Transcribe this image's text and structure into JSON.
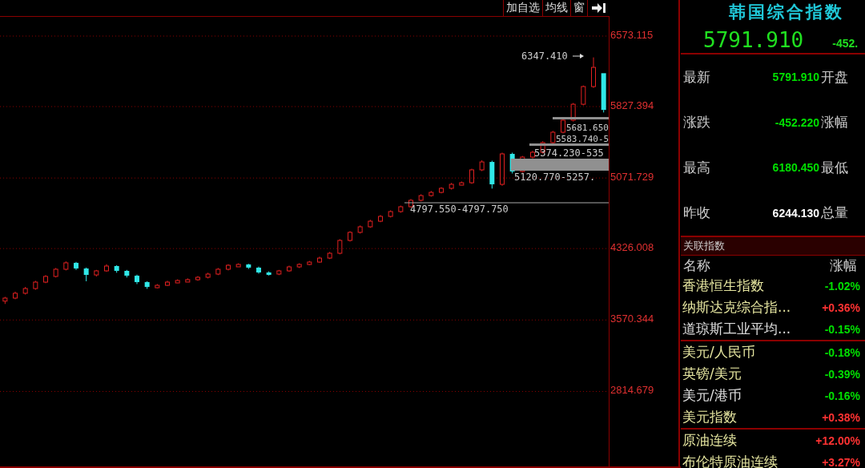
{
  "toolbar": {
    "buttons": [
      "加自选",
      "均线",
      "窗"
    ]
  },
  "chart_data": {
    "type": "candlestick",
    "grid": true,
    "ylim": [
      2022,
      6785
    ],
    "ohlc": [
      [
        3770,
        3815,
        3740,
        3802
      ],
      [
        3802,
        3870,
        3790,
        3853
      ],
      [
        3853,
        3920,
        3840,
        3903
      ],
      [
        3903,
        3985,
        3890,
        3971
      ],
      [
        3971,
        4045,
        3960,
        4031
      ],
      [
        4031,
        4120,
        4020,
        4107
      ],
      [
        4107,
        4190,
        4095,
        4175
      ],
      [
        4175,
        4185,
        4100,
        4115
      ],
      [
        4115,
        4125,
        3980,
        4047
      ],
      [
        4047,
        4100,
        4030,
        4090
      ],
      [
        4090,
        4160,
        4080,
        4141
      ],
      [
        4141,
        4150,
        4070,
        4090
      ],
      [
        4090,
        4100,
        4020,
        4039
      ],
      [
        4039,
        4050,
        3950,
        3971
      ],
      [
        3971,
        3980,
        3900,
        3920
      ],
      [
        3920,
        3950,
        3905,
        3937
      ],
      [
        3937,
        3985,
        3930,
        3971
      ],
      [
        3971,
        4000,
        3960,
        3988
      ],
      [
        3988,
        4010,
        3980,
        3997
      ],
      [
        3997,
        4035,
        3985,
        4022
      ],
      [
        4022,
        4070,
        4010,
        4056
      ],
      [
        4056,
        4120,
        4045,
        4107
      ],
      [
        4107,
        4160,
        4095,
        4149
      ],
      [
        4149,
        4170,
        4140,
        4158
      ],
      [
        4158,
        4165,
        4110,
        4124
      ],
      [
        4124,
        4135,
        4060,
        4073
      ],
      [
        4073,
        4085,
        4040,
        4056
      ],
      [
        4056,
        4100,
        4045,
        4090
      ],
      [
        4090,
        4145,
        4080,
        4132
      ],
      [
        4132,
        4170,
        4120,
        4158
      ],
      [
        4158,
        4195,
        4150,
        4183
      ],
      [
        4183,
        4240,
        4175,
        4225
      ],
      [
        4225,
        4290,
        4215,
        4276
      ],
      [
        4276,
        4425,
        4265,
        4412
      ],
      [
        4412,
        4510,
        4400,
        4497
      ],
      [
        4497,
        4570,
        4485,
        4556
      ],
      [
        4556,
        4630,
        4545,
        4615
      ],
      [
        4615,
        4680,
        4605,
        4666
      ],
      [
        4666,
        4730,
        4655,
        4717
      ],
      [
        4717,
        4780,
        4705,
        4768
      ],
      [
        4768,
        4850,
        4758,
        4836
      ],
      [
        4836,
        4900,
        4825,
        4886
      ],
      [
        4886,
        4935,
        4875,
        4920
      ],
      [
        4920,
        4975,
        4910,
        4963
      ],
      [
        4963,
        5020,
        4950,
        5005
      ],
      [
        5005,
        5035,
        4995,
        5022
      ],
      [
        5022,
        5170,
        5010,
        5158
      ],
      [
        5158,
        5260,
        5145,
        5242
      ],
      [
        5242,
        5255,
        4960,
        5005
      ],
      [
        5005,
        5340,
        4990,
        5327
      ],
      [
        5327,
        5340,
        5120,
        5141
      ],
      [
        5141,
        5305,
        5130,
        5293
      ],
      [
        5293,
        5360,
        5280,
        5344
      ],
      [
        5344,
        5460,
        5330,
        5446
      ],
      [
        5446,
        5570,
        5435,
        5556
      ],
      [
        5556,
        5695,
        5545,
        5683
      ],
      [
        5683,
        5865,
        5670,
        5852
      ],
      [
        5852,
        6050,
        5840,
        6039
      ],
      [
        6039,
        6347.41,
        6025,
        6242
      ],
      [
        6180.45,
        6180.45,
        5765,
        5791.91
      ]
    ],
    "yticks": [
      {
        "value": 6573.115,
        "label": "6573.115"
      },
      {
        "value": 5827.394,
        "label": "5827.394"
      },
      {
        "value": 5071.729,
        "label": "5071.729"
      },
      {
        "value": 4326.008,
        "label": "4326.008"
      },
      {
        "value": 3570.344,
        "label": "3570.344"
      },
      {
        "value": 2814.679,
        "label": "2814.679"
      }
    ]
  },
  "annotations": [
    {
      "kind": "arrow",
      "text": "6347.410"
    },
    {
      "kind": "gap",
      "text": "5681.650"
    },
    {
      "kind": "plain",
      "text": "5583.740-5"
    },
    {
      "kind": "gap",
      "text": "5374.230-535"
    },
    {
      "kind": "band",
      "text": "5120.770-5257."
    },
    {
      "kind": "line",
      "text": "4797.550-4797.750"
    }
  ],
  "quote": {
    "name": "韩国综合指数",
    "price": "5791.910",
    "change": "-452."
  },
  "stats": [
    {
      "label": "最新",
      "value": "5791.910",
      "color": "#00e000",
      "next_label": "开盘"
    },
    {
      "label": "涨跌",
      "value": "-452.220",
      "color": "#00e000",
      "next_label": "涨幅"
    },
    {
      "label": "最高",
      "value": "6180.450",
      "color": "#00e000",
      "next_label": "最低"
    },
    {
      "label": "昨收",
      "value": "6244.130",
      "color": "#ffffff",
      "next_label": "总量"
    }
  ],
  "related": {
    "title": "关联指数",
    "columns": [
      "名称",
      "涨幅"
    ],
    "groups": [
      [
        {
          "name": {
            "text": "香港恒生指数",
            "color": "#e6e6a0"
          },
          "change": {
            "text": "-1.02%",
            "color": "#00e000"
          }
        },
        {
          "name": {
            "text": "纳斯达克综合指...",
            "color": "#e6e6a0"
          },
          "change": {
            "text": "+0.36%",
            "color": "#ff3232"
          }
        },
        {
          "name": {
            "text": "道琼斯工业平均...",
            "color": "#e0e0e0"
          },
          "change": {
            "text": "-0.15%",
            "color": "#00e000"
          }
        }
      ],
      [
        {
          "name": {
            "text": "美元/人民币",
            "color": "#e6e6a0"
          },
          "change": {
            "text": "-0.18%",
            "color": "#00e000"
          }
        },
        {
          "name": {
            "text": "英镑/美元",
            "color": "#e6e6a0"
          },
          "change": {
            "text": "-0.39%",
            "color": "#00e000"
          }
        },
        {
          "name": {
            "text": "美元/港币",
            "color": "#e0e0e0"
          },
          "change": {
            "text": "-0.16%",
            "color": "#00e000"
          }
        },
        {
          "name": {
            "text": "美元指数",
            "color": "#e6e6a0"
          },
          "change": {
            "text": "+0.38%",
            "color": "#ff3232"
          }
        }
      ],
      [
        {
          "name": {
            "text": "原油连续",
            "color": "#e6e6a0"
          },
          "change": {
            "text": "+12.00%",
            "color": "#ff3232"
          }
        },
        {
          "name": {
            "text": "布伦特原油连续",
            "color": "#e6e6a0"
          },
          "change": {
            "text": "+3.27%",
            "color": "#ff3232"
          }
        }
      ]
    ]
  }
}
